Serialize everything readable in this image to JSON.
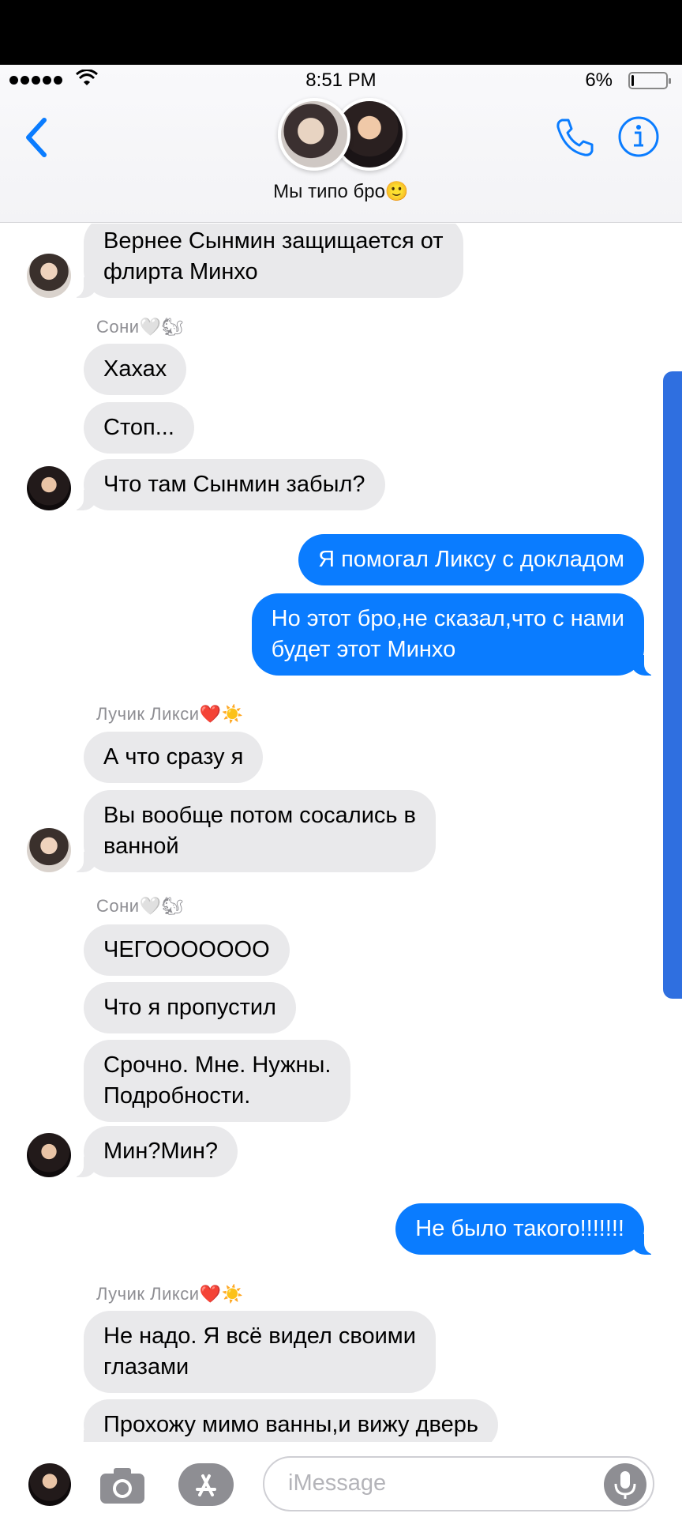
{
  "status_bar": {
    "time": "8:51 PM",
    "battery_percent": "6%",
    "battery_level": 0.06
  },
  "header": {
    "chat_title": "Мы типо бро🙂"
  },
  "composer": {
    "placeholder": "iMessage"
  },
  "messages": [
    {
      "type": "in",
      "text": "Вернее Сынмин защищается от\nфлирта Минхо",
      "avatar": "a"
    },
    {
      "type": "sender",
      "text": "Сони🤍🐿"
    },
    {
      "type": "in",
      "text": "Хахах"
    },
    {
      "type": "in",
      "text": "Стоп..."
    },
    {
      "type": "in",
      "text": "Что там Сынмин забыл?",
      "avatar": "b"
    },
    {
      "type": "out",
      "text": "Я помогал Ликсу с докладом"
    },
    {
      "type": "out",
      "text": "Но этот бро,не сказал,что с нами\nбудет этот Минхо"
    },
    {
      "type": "sender",
      "text": "Лучик Ликси❤️☀️"
    },
    {
      "type": "in",
      "text": "А что сразу я"
    },
    {
      "type": "in",
      "text": "Вы вообще потом сосались в\nванной",
      "avatar": "a"
    },
    {
      "type": "sender",
      "text": "Сони🤍🐿"
    },
    {
      "type": "in",
      "text": "ЧЕГООООООО"
    },
    {
      "type": "in",
      "text": "Что я пропустил"
    },
    {
      "type": "in",
      "text": "Срочно. Мне. Нужны.\nПодробности."
    },
    {
      "type": "in",
      "text": "Мин?Мин?",
      "avatar": "b"
    },
    {
      "type": "out",
      "text": "Не было такого!!!!!!!"
    },
    {
      "type": "sender",
      "text": "Лучик Ликси❤️☀️"
    },
    {
      "type": "in",
      "text": "Не надо. Я всё видел своими\nглазами"
    },
    {
      "type": "in",
      "text": "Прохожу мимо ванны,и вижу дверь"
    }
  ]
}
